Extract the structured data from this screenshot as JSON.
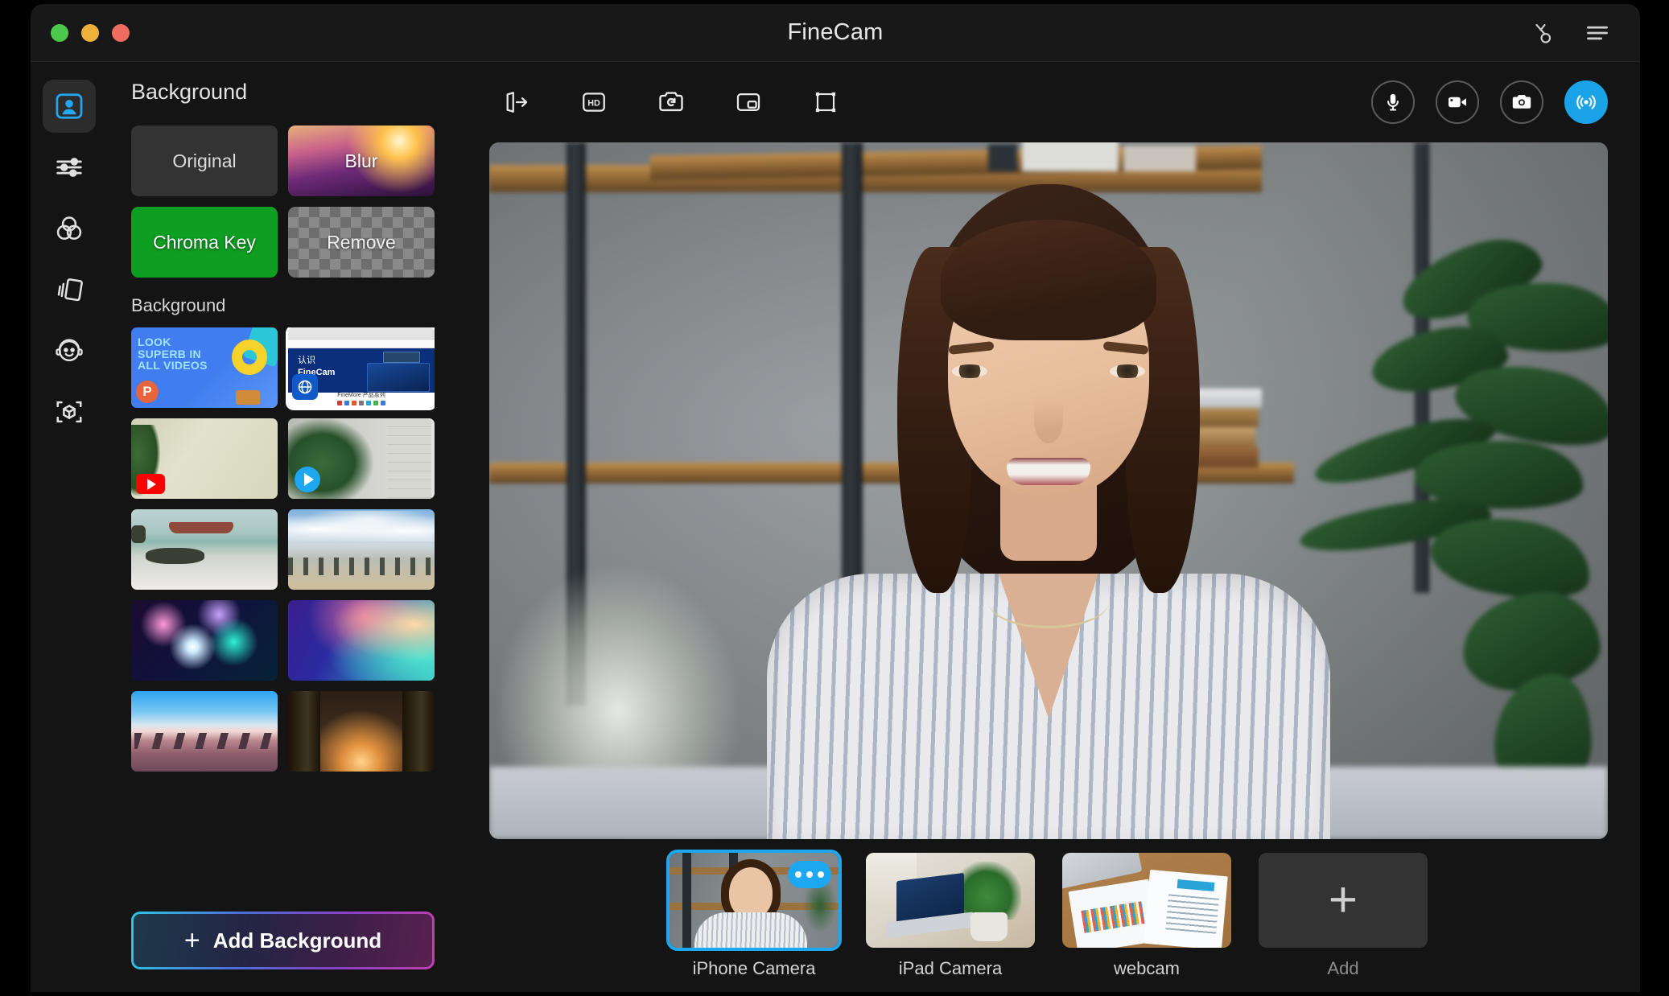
{
  "window": {
    "title": "FineCam",
    "traffic_lights": [
      "green",
      "yellow",
      "red"
    ],
    "right_icons": [
      {
        "name": "scissors-icon",
        "label": "Cut"
      },
      {
        "name": "hamburger-menu-icon",
        "label": "Menu"
      }
    ]
  },
  "rail": {
    "items": [
      {
        "name": "background-tab",
        "label": "Background",
        "icon": "person-frame-icon",
        "active": true
      },
      {
        "name": "adjust-tab",
        "label": "Adjust",
        "icon": "sliders-icon",
        "active": false
      },
      {
        "name": "filters-tab",
        "label": "Filters",
        "icon": "color-circles-icon",
        "active": false
      },
      {
        "name": "layouts-tab",
        "label": "Layouts",
        "icon": "cards-stack-icon",
        "active": false
      },
      {
        "name": "avatar-tab",
        "label": "Avatar",
        "icon": "face-headset-icon",
        "active": false
      },
      {
        "name": "ar-tab",
        "label": "AR Objects",
        "icon": "cube-scan-icon",
        "active": false
      }
    ]
  },
  "panel": {
    "title": "Background",
    "presets": [
      {
        "label": "Original",
        "style": "original",
        "selected": false
      },
      {
        "label": "Blur",
        "style": "blur",
        "selected": false
      },
      {
        "label": "Chroma Key",
        "style": "chroma",
        "selected": false
      },
      {
        "label": "Remove",
        "style": "remove",
        "selected": false
      }
    ],
    "section_label": "Background",
    "backgrounds": [
      {
        "name": "bg-ppt-look-superb",
        "art": "t-ppt",
        "selected": false,
        "headline": "LOOK\nSUPERB IN\nALL VIDEOS",
        "badge": "P"
      },
      {
        "name": "bg-finecam-website",
        "art": "t-web",
        "selected": true,
        "hero_title_cn": "认识",
        "hero_brand": "FineCam",
        "footer_text": "FineMore 产品系列"
      },
      {
        "name": "bg-room-youtube",
        "art": "t-room",
        "selected": false,
        "overlay": "youtube-icon"
      },
      {
        "name": "bg-plant-window",
        "art": "t-plant",
        "selected": false,
        "overlay": "play-icon"
      },
      {
        "name": "bg-shipwreck-beach",
        "art": "t-ship",
        "selected": false
      },
      {
        "name": "bg-cloudy-bay",
        "art": "t-bay",
        "selected": false
      },
      {
        "name": "bg-bokeh-lights",
        "art": "t-bokeh",
        "selected": false
      },
      {
        "name": "bg-gradient-mesh",
        "art": "t-grad",
        "selected": false
      },
      {
        "name": "bg-pink-dunes",
        "art": "t-dune",
        "selected": false
      },
      {
        "name": "bg-forest-light",
        "art": "t-forest",
        "selected": false
      }
    ],
    "add_background_label": "Add Background",
    "add_glyph": "+"
  },
  "toolbar": {
    "left_tools": [
      {
        "name": "mirror-flip-icon",
        "label": "Mirror"
      },
      {
        "name": "hd-quality-icon",
        "label": "HD"
      },
      {
        "name": "switch-camera-icon",
        "label": "Switch Camera"
      },
      {
        "name": "picture-in-picture-icon",
        "label": "Picture in Picture"
      },
      {
        "name": "crop-frame-icon",
        "label": "Crop"
      }
    ],
    "right_tools": [
      {
        "name": "microphone-button",
        "label": "Microphone",
        "active": false
      },
      {
        "name": "record-video-button",
        "label": "Record Video",
        "active": false
      },
      {
        "name": "snapshot-button",
        "label": "Snapshot",
        "active": false
      },
      {
        "name": "live-broadcast-button",
        "label": "Live",
        "active": true
      }
    ]
  },
  "preview": {
    "name": "video-preview",
    "description": "Woman smiling in front of shelving unit with books and a potted plant"
  },
  "cameras": {
    "items": [
      {
        "name": "camera-iphone",
        "label": "iPhone Camera",
        "art": "c1",
        "selected": true,
        "has_menu": true
      },
      {
        "name": "camera-ipad",
        "label": "iPad Camera",
        "art": "c2",
        "selected": false,
        "has_menu": false
      },
      {
        "name": "camera-webcam",
        "label": "webcam",
        "art": "c3",
        "selected": false,
        "has_menu": false
      },
      {
        "name": "camera-add",
        "label": "Add",
        "art": "add",
        "selected": false,
        "has_menu": false
      }
    ]
  },
  "colors": {
    "accent_blue": "#1ca7f0",
    "chroma_green": "#0e9e22",
    "panel_bg": "#141414",
    "titlebar_bg": "#181818",
    "selected_border": "#ffffff"
  }
}
